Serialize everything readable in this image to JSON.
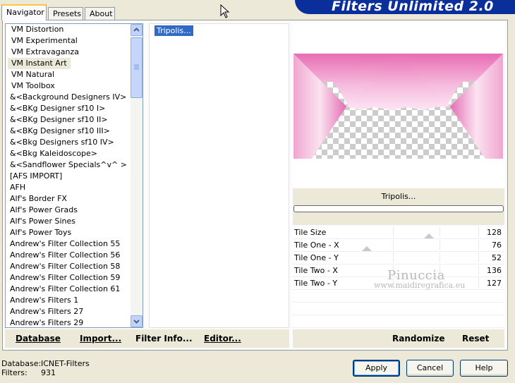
{
  "tabs": [
    {
      "label": "Navigator",
      "active": true
    },
    {
      "label": "Presets",
      "active": false
    },
    {
      "label": "About",
      "active": false
    }
  ],
  "header": {
    "title": "Filters Unlimited 2.0"
  },
  "filter_list": {
    "items": [
      "VM Distortion",
      "VM Experimental",
      "VM Extravaganza",
      "VM Instant Art",
      "VM Natural",
      "VM Toolbox",
      "&<Background Designers IV>",
      "&<BKg Designer sf10 I>",
      "&<BKg Designer sf10 II>",
      "&<BKg Designer sf10 III>",
      "&<Bkg Designers sf10 IV>",
      "&<Bkg Kaleidoscope>",
      "&<Sandflower Specials^v^ >",
      "[AFS IMPORT]",
      "AFH",
      "Alf's Border FX",
      "Alf's Power Grads",
      "Alf's Power Sines",
      "Alf's Power Toys",
      "Andrew's Filter Collection 55",
      "Andrew's Filter Collection 56",
      "Andrew's Filter Collection 58",
      "Andrew's Filter Collection 59",
      "Andrew's Filter Collection 61",
      "Andrew's Filters 1",
      "Andrew's Filters 27",
      "Andrew's Filters 29"
    ],
    "selected_index": 3
  },
  "effect_list": {
    "items": [
      "Tripolis..."
    ],
    "selected_index": 0
  },
  "preview": {
    "filter_name": "Tripolis...",
    "progress": 0
  },
  "sliders": [
    {
      "label": "Tile Size",
      "value": "128",
      "level": 0.5
    },
    {
      "label": "Tile One - X",
      "value": "76",
      "level": 0.098
    },
    {
      "label": "Tile One - Y",
      "value": "52",
      "level": 0.0
    },
    {
      "label": "Tile Two - X",
      "value": "136",
      "level": 0.0
    },
    {
      "label": "Tile Two - Y",
      "value": "127",
      "level": 0.0
    }
  ],
  "watermark": {
    "name": "Pinuccia",
    "url": "www.maidiregrafica.eu"
  },
  "actions": {
    "database": "Database",
    "import": "Import...",
    "filter_info": "Filter Info...",
    "editor": "Editor...",
    "randomize": "Randomize",
    "reset": "Reset"
  },
  "info": {
    "database_label": "Database:",
    "database_value": "ICNET-Filters",
    "filters_label": "Filters:",
    "filters_value": "931"
  },
  "buttons": {
    "apply": "Apply",
    "cancel": "Cancel",
    "help": "Help"
  },
  "colors": {
    "accent_pink": "#e87ab9",
    "selection_blue": "#316ac5",
    "banner_blue": "#0a2f9b"
  }
}
